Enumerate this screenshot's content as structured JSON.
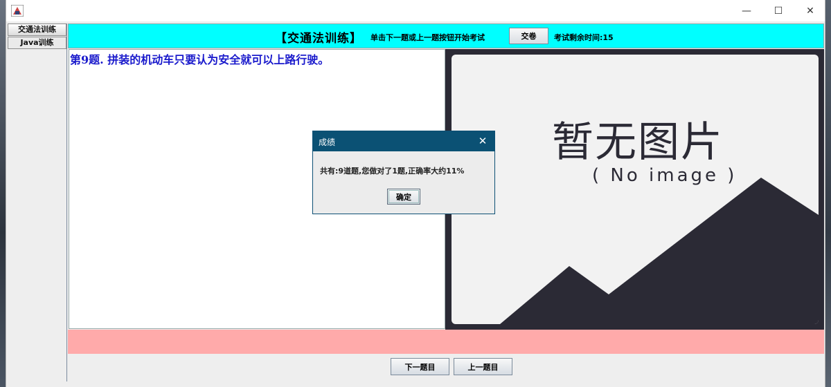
{
  "window": {
    "controls": {
      "minimize": "—",
      "maximize": "☐",
      "close": "✕"
    }
  },
  "tabs": [
    {
      "label": "交通法训练",
      "active": true
    },
    {
      "label": "Java训练",
      "active": false
    }
  ],
  "header": {
    "title": "【交通法训练】",
    "hint": "单击下一题或上一题按钮开始考试",
    "submit_label": "交卷",
    "timer_label": "考试剩余时间:15",
    "background": "#00ffff"
  },
  "question": {
    "text": "第9题. 拼装的机动车只要认为安全就可以上路行驶。",
    "color": "#1a1acc"
  },
  "image_placeholder": {
    "title": "暂无图片",
    "subtitle": "( No image )"
  },
  "status_bar": {
    "color": "#ffaaaa"
  },
  "nav": {
    "next_label": "下一题目",
    "prev_label": "上一题目"
  },
  "dialog": {
    "title": "成绩",
    "message": "共有:9道题,您做对了1题,正确率大约11%",
    "ok_label": "确定",
    "close_symbol": "✕"
  }
}
